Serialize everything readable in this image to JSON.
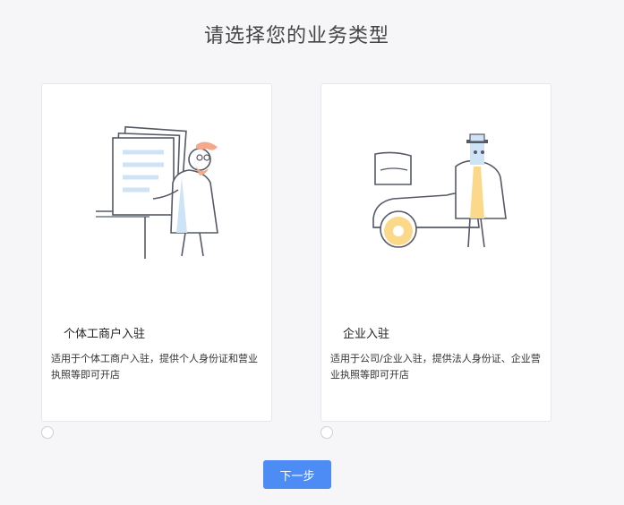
{
  "page": {
    "title": "请选择您的业务类型"
  },
  "cards": {
    "personal": {
      "title": "个体工商户入驻",
      "description": "适用于个体工商户入驻，提供个人身份证和营业执照等即可开店",
      "illustration_icon": "person-with-documents-illustration"
    },
    "company": {
      "title": "企业入驻",
      "description": "适用于公司/企业入驻，提供法人身份证、企业营业执照等即可开店",
      "illustration_icon": "businessman-with-car-illustration"
    }
  },
  "actions": {
    "next_label": "下一步"
  },
  "colors": {
    "accent": "#4d8cf5",
    "illustration_blue": "#cfe3f7",
    "illustration_orange": "#f5a88a",
    "illustration_yellow": "#fcd98a",
    "stroke": "#555a66"
  }
}
